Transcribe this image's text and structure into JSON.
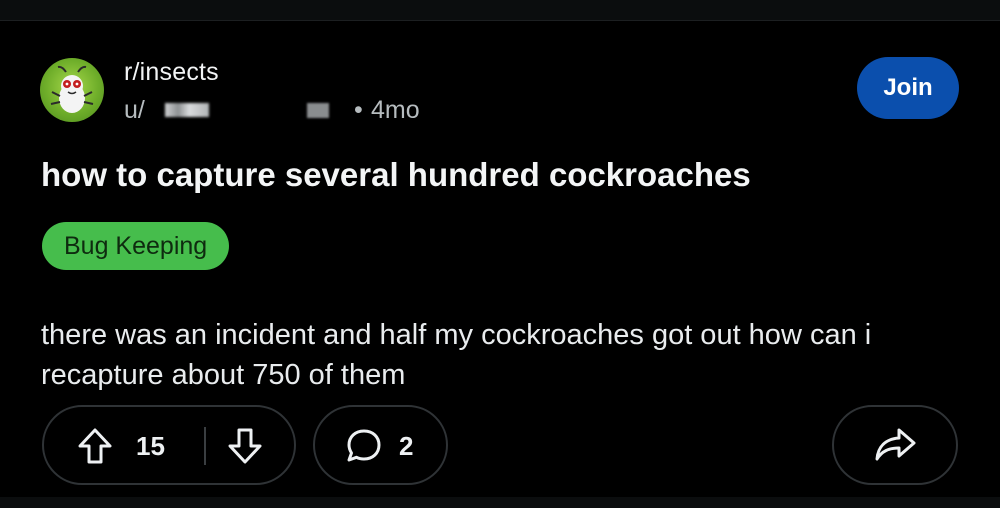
{
  "post": {
    "subreddit": "r/insects",
    "user_prefix": "u/",
    "separator": "•",
    "age": "4mo",
    "join_label": "Join",
    "title": "how to capture several hundred cockroaches",
    "flair": "Bug Keeping",
    "body": "there was an incident and half my cockroaches got out how can i recapture about 750 of them",
    "votes": "15",
    "comments": "2"
  },
  "colors": {
    "background": "#000000",
    "join_button": "#0b4fad",
    "flair": "#46bd4c",
    "avatar": "#6fae2a"
  },
  "icons": {
    "upvote": "arrow-up-icon",
    "downvote": "arrow-down-icon",
    "comment": "comment-bubble-icon",
    "share": "share-arrow-icon",
    "avatar": "subreddit-avatar-icon"
  }
}
